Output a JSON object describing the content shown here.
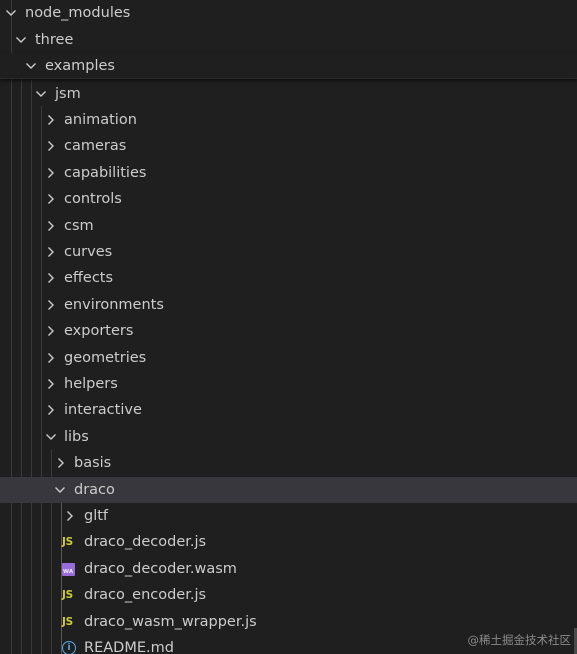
{
  "explorer": {
    "items": [
      {
        "label": "node_modules",
        "expanded": true,
        "kind": "folder"
      },
      {
        "label": "three",
        "expanded": true,
        "kind": "folder"
      },
      {
        "label": "examples",
        "expanded": true,
        "kind": "folder"
      },
      {
        "label": "jsm",
        "expanded": true,
        "kind": "folder"
      },
      {
        "label": "animation",
        "expanded": false,
        "kind": "folder"
      },
      {
        "label": "cameras",
        "expanded": false,
        "kind": "folder"
      },
      {
        "label": "capabilities",
        "expanded": false,
        "kind": "folder"
      },
      {
        "label": "controls",
        "expanded": false,
        "kind": "folder"
      },
      {
        "label": "csm",
        "expanded": false,
        "kind": "folder"
      },
      {
        "label": "curves",
        "expanded": false,
        "kind": "folder"
      },
      {
        "label": "effects",
        "expanded": false,
        "kind": "folder"
      },
      {
        "label": "environments",
        "expanded": false,
        "kind": "folder"
      },
      {
        "label": "exporters",
        "expanded": false,
        "kind": "folder"
      },
      {
        "label": "geometries",
        "expanded": false,
        "kind": "folder"
      },
      {
        "label": "helpers",
        "expanded": false,
        "kind": "folder"
      },
      {
        "label": "interactive",
        "expanded": false,
        "kind": "folder"
      },
      {
        "label": "libs",
        "expanded": true,
        "kind": "folder"
      },
      {
        "label": "basis",
        "expanded": false,
        "kind": "folder"
      },
      {
        "label": "draco",
        "expanded": true,
        "kind": "folder",
        "selected": true
      },
      {
        "label": "gltf",
        "expanded": false,
        "kind": "folder"
      },
      {
        "label": "draco_decoder.js",
        "kind": "file",
        "icon": "js-file-icon",
        "icon_text": "JS"
      },
      {
        "label": "draco_decoder.wasm",
        "kind": "file",
        "icon": "wasm-file-icon",
        "icon_text": "WA"
      },
      {
        "label": "draco_encoder.js",
        "kind": "file",
        "icon": "js-file-icon",
        "icon_text": "JS"
      },
      {
        "label": "draco_wasm_wrapper.js",
        "kind": "file",
        "icon": "js-file-icon",
        "icon_text": "JS"
      },
      {
        "label": "README.md",
        "kind": "file",
        "icon": "info-file-icon",
        "icon_text": "i"
      }
    ]
  },
  "watermark": "@稀土掘金技术社区",
  "colors": {
    "background": "#1f1f1f",
    "selected_row": "#37373d",
    "text": "#cccccc",
    "js_icon": "#cbcb41",
    "wasm_icon": "#9a6cd9",
    "info_icon": "#5aa9e6"
  }
}
